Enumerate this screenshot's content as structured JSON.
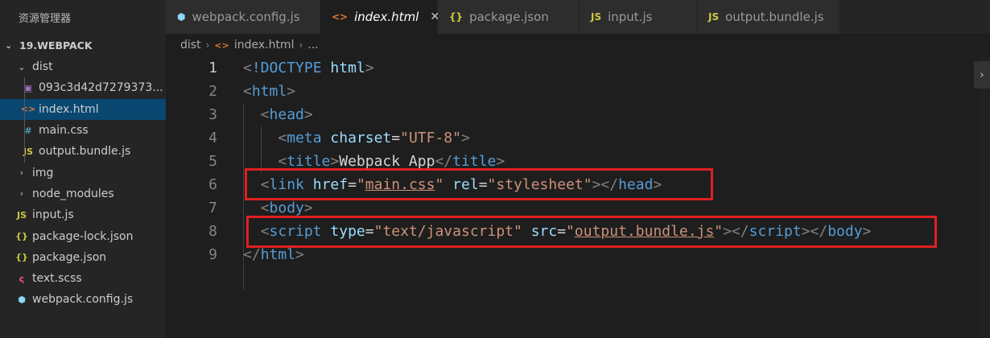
{
  "sidebar": {
    "title": "资源管理器",
    "project": "19.WEBPACK",
    "items": [
      {
        "label": "dist",
        "chevron": "⌄",
        "icon": "",
        "icon_color": "#cccccc",
        "depth": 1,
        "selected": false
      },
      {
        "label": "093c3d42d7279373...",
        "chevron": "",
        "icon": "image-icon",
        "icon_color": "#a074c4",
        "depth": 2,
        "selected": false
      },
      {
        "label": "index.html",
        "chevron": "",
        "icon": "html-icon",
        "icon_color": "#e37933",
        "depth": 2,
        "selected": true
      },
      {
        "label": "main.css",
        "chevron": "",
        "icon": "css-icon",
        "icon_color": "#519aba",
        "depth": 2,
        "selected": false
      },
      {
        "label": "output.bundle.js",
        "chevron": "",
        "icon": "js-icon",
        "icon_color": "#cbcb41",
        "depth": 2,
        "selected": false
      },
      {
        "label": "img",
        "chevron": "›",
        "icon": "",
        "icon_color": "#cccccc",
        "depth": 1,
        "selected": false
      },
      {
        "label": "node_modules",
        "chevron": "›",
        "icon": "",
        "icon_color": "#cccccc",
        "depth": 1,
        "selected": false
      },
      {
        "label": "input.js",
        "chevron": "",
        "icon": "js-icon",
        "icon_color": "#cbcb41",
        "depth": 1,
        "selected": false
      },
      {
        "label": "package-lock.json",
        "chevron": "",
        "icon": "json-icon",
        "icon_color": "#cbcb41",
        "depth": 1,
        "selected": false
      },
      {
        "label": "package.json",
        "chevron": "",
        "icon": "json-icon",
        "icon_color": "#cbcb41",
        "depth": 1,
        "selected": false
      },
      {
        "label": "text.scss",
        "chevron": "",
        "icon": "sass-icon",
        "icon_color": "#f55385",
        "depth": 1,
        "selected": false
      },
      {
        "label": "webpack.config.js",
        "chevron": "",
        "icon": "webpack-icon",
        "icon_color": "#8ed6fb",
        "depth": 1,
        "selected": false
      }
    ]
  },
  "tabs": [
    {
      "label": "webpack.config.js",
      "icon": "webpack-icon",
      "active": false
    },
    {
      "label": "index.html",
      "icon": "html-icon",
      "active": true
    },
    {
      "label": "package.json",
      "icon": "json-icon",
      "active": false
    },
    {
      "label": "input.js",
      "icon": "js-icon",
      "active": false
    },
    {
      "label": "output.bundle.js",
      "icon": "js-icon",
      "active": false
    }
  ],
  "icon_glyphs": {
    "webpack-icon": "⬢",
    "html-icon": "<>",
    "json-icon": "{}",
    "js-icon": "JS",
    "css-icon": "#",
    "image-icon": "▣",
    "sass-icon": "ς"
  },
  "breadcrumb": {
    "folder": "dist",
    "file": "index.html",
    "more": "..."
  },
  "editor": {
    "current_line": 1,
    "lines": [
      {
        "n": "1",
        "tokens": [
          [
            "br",
            "<"
          ],
          [
            "tg",
            "!DOCTYPE"
          ],
          [
            "tx",
            " "
          ],
          [
            "at",
            "html"
          ],
          [
            "br",
            ">"
          ]
        ]
      },
      {
        "n": "2",
        "tokens": [
          [
            "br",
            "<"
          ],
          [
            "tg",
            "html"
          ],
          [
            "br",
            ">"
          ]
        ]
      },
      {
        "n": "3",
        "tokens": [
          [
            "tx",
            "  "
          ],
          [
            "br",
            "<"
          ],
          [
            "tg",
            "head"
          ],
          [
            "br",
            ">"
          ]
        ]
      },
      {
        "n": "4",
        "tokens": [
          [
            "tx",
            "    "
          ],
          [
            "br",
            "<"
          ],
          [
            "tg",
            "meta"
          ],
          [
            "tx",
            " "
          ],
          [
            "at",
            "charset"
          ],
          [
            "tx",
            "="
          ],
          [
            "st",
            "\"UTF-8\""
          ],
          [
            "br",
            ">"
          ]
        ]
      },
      {
        "n": "5",
        "tokens": [
          [
            "tx",
            "    "
          ],
          [
            "br",
            "<"
          ],
          [
            "tg",
            "title"
          ],
          [
            "br",
            ">"
          ],
          [
            "tx",
            "Webpack App"
          ],
          [
            "br",
            "</"
          ],
          [
            "tg",
            "title"
          ],
          [
            "br",
            ">"
          ]
        ]
      },
      {
        "n": "6",
        "tokens": [
          [
            "tx",
            "  "
          ],
          [
            "br",
            "<"
          ],
          [
            "tg",
            "link"
          ],
          [
            "tx",
            " "
          ],
          [
            "at",
            "href"
          ],
          [
            "tx",
            "="
          ],
          [
            "st",
            "\""
          ],
          [
            "st ul",
            "main.css"
          ],
          [
            "st",
            "\""
          ],
          [
            "tx",
            " "
          ],
          [
            "at",
            "rel"
          ],
          [
            "tx",
            "="
          ],
          [
            "st",
            "\"stylesheet\""
          ],
          [
            "br",
            "></"
          ],
          [
            "tg",
            "head"
          ],
          [
            "br",
            ">"
          ]
        ]
      },
      {
        "n": "7",
        "tokens": [
          [
            "tx",
            "  "
          ],
          [
            "br",
            "<"
          ],
          [
            "tg",
            "body"
          ],
          [
            "br",
            ">"
          ]
        ]
      },
      {
        "n": "8",
        "tokens": [
          [
            "tx",
            "  "
          ],
          [
            "br",
            "<"
          ],
          [
            "tg",
            "script"
          ],
          [
            "tx",
            " "
          ],
          [
            "at",
            "type"
          ],
          [
            "tx",
            "="
          ],
          [
            "st",
            "\"text/javascript\""
          ],
          [
            "tx",
            " "
          ],
          [
            "at",
            "src"
          ],
          [
            "tx",
            "="
          ],
          [
            "st",
            "\""
          ],
          [
            "st ul",
            "output.bundle.js"
          ],
          [
            "st",
            "\""
          ],
          [
            "br",
            "></"
          ],
          [
            "tg",
            "script"
          ],
          [
            "br",
            "></"
          ],
          [
            "tg",
            "body"
          ],
          [
            "br",
            ">"
          ]
        ]
      },
      {
        "n": "9",
        "tokens": [
          [
            "br",
            "</"
          ],
          [
            "tg",
            "html"
          ],
          [
            "br",
            ">"
          ]
        ]
      }
    ]
  },
  "colors": {
    "highlight_box": "#e02020",
    "selection": "#094771"
  }
}
